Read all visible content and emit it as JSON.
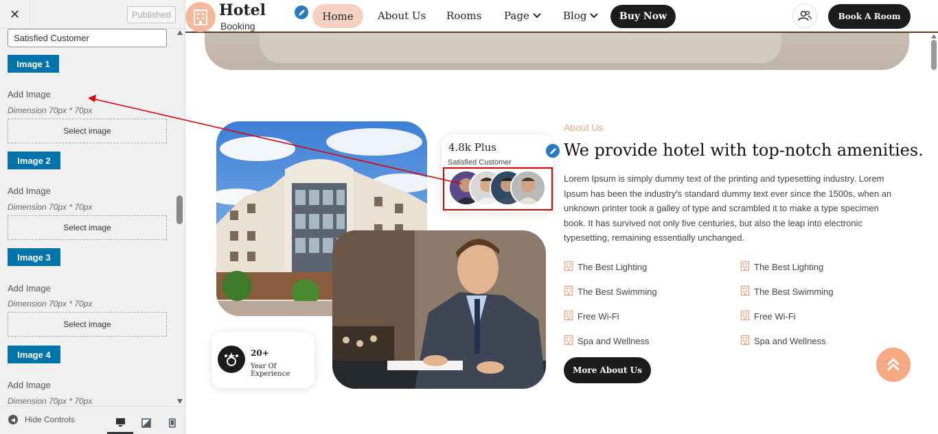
{
  "customizer": {
    "close_icon": "close-icon",
    "published_label": "Published",
    "text_value": "Satisfied Customer",
    "images": [
      {
        "button": "Image 1",
        "add_label": "Add Image",
        "dimension": "Dimension 70px * 70px",
        "select": "Select image"
      },
      {
        "button": "Image 2",
        "add_label": "Add Image",
        "dimension": "Dimension 70px * 70px",
        "select": "Select image"
      },
      {
        "button": "Image 3",
        "add_label": "Add Image",
        "dimension": "Dimension 70px * 70px",
        "select": "Select image"
      },
      {
        "button": "Image 4",
        "add_label": "Add Image",
        "dimension": "Dimension 70px * 70px"
      }
    ],
    "hide_controls": "Hide Controls"
  },
  "site": {
    "logo_title": "Hotel",
    "logo_sub": "Booking",
    "nav": {
      "home": "Home",
      "about": "About Us",
      "rooms": "Rooms",
      "page": "Page",
      "blog": "Blog"
    },
    "buy_now": "Buy Now",
    "book_room": "Book A Room",
    "experience": {
      "number": "20+",
      "label": "Year Of Experience"
    },
    "customers": {
      "number": "4.8k Plus",
      "label": "Satisfied Customer"
    },
    "about": {
      "tag": "About Us",
      "title": "We provide hotel with top-notch amenities.",
      "paragraph": "Lorem Ipsum is simply dummy text of the printing and typesetting industry. Lorem Ipsum has been the industry's standard dummy text ever since the 1500s, when an unknown printer took a galley of type and scrambled it to make a type specimen book. It has survived not only five centuries, but also the leap into electronic typesetting, remaining essentially unchanged.",
      "features_left": [
        "The Best Lighting",
        "The Best Swimming",
        "Free Wi-Fi",
        "Spa and Wellness"
      ],
      "features_right": [
        "The Best Lighting",
        "The Best Swimming",
        "Free Wi-Fi",
        "Spa and Wellness"
      ],
      "more_button": "More About Us"
    }
  },
  "colors": {
    "accent": "#f4a37d",
    "customizer_blue": "#0073aa",
    "dark": "#1c1c1c",
    "highlight": "#d90000"
  }
}
